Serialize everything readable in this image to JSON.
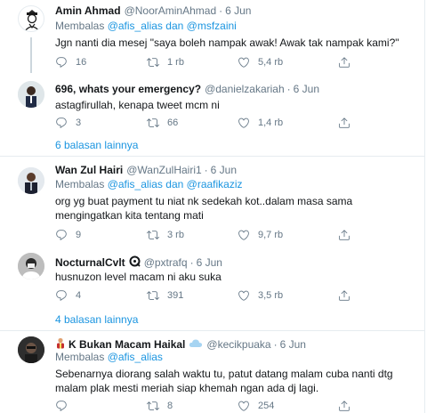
{
  "tweets": [
    {
      "name": "Amin Ahmad",
      "handle": "@NoorAminAhmad",
      "time": "6 Jun",
      "reply_prefix": "Membalas",
      "reply_user1": "@afis_alias",
      "reply_and": "dan",
      "reply_user2": "@msfzaini",
      "text": "Jgn nanti dia mesej \"saya boleh nampak awak! Awak tak nampak kami?\"",
      "replies": "16",
      "retweets": "1 rb",
      "likes": "5,4 rb"
    },
    {
      "name": "696, whats your emergency?",
      "handle": "@danielzakariah",
      "time": "6 Jun",
      "text": "astagfirullah, kenapa tweet mcm ni",
      "replies": "3",
      "retweets": "66",
      "likes": "1,4 rb"
    },
    {
      "name": "Wan Zul Hairi",
      "handle": "@WanZulHairi1",
      "time": "6 Jun",
      "reply_prefix": "Membalas",
      "reply_user1": "@afis_alias",
      "reply_and": "dan",
      "reply_user2": "@raafikaziz",
      "text": "org yg buat payment tu niat nk sedekah kot..dalam masa sama mengingatkan kita tentang mati",
      "replies": "9",
      "retweets": "3 rb",
      "likes": "9,7 rb"
    },
    {
      "name": "NocturnalCvlt",
      "handle": "@pxtrafq",
      "time": "6 Jun",
      "text": "husnuzon level macam ni aku suka",
      "replies": "4",
      "retweets": "391",
      "likes": "3,5 rb"
    },
    {
      "name": "K Bukan Macam Haikal",
      "handle": "@kecikpuaka",
      "time": "6 Jun",
      "reply_prefix": "Membalas",
      "reply_user1": "@afis_alias",
      "text": "Sebenarnya diorang salah waktu tu, patut datang malam cuba nanti dtg malam plak mesti meriah siap khemah ngan ada dj lagi.",
      "replies": "",
      "retweets": "8",
      "likes": "254"
    }
  ],
  "more_links": [
    "6 balasan lainnya",
    "4 balasan lainnya"
  ],
  "dot": "·",
  "colors": {
    "link": "#1b95e0",
    "muted": "#657786",
    "text": "#14171a",
    "separator": "#e6ecf0"
  },
  "icons": [
    "reply-icon",
    "retweet-icon",
    "like-icon",
    "share-icon",
    "badge-icon",
    "cloud-icon"
  ]
}
